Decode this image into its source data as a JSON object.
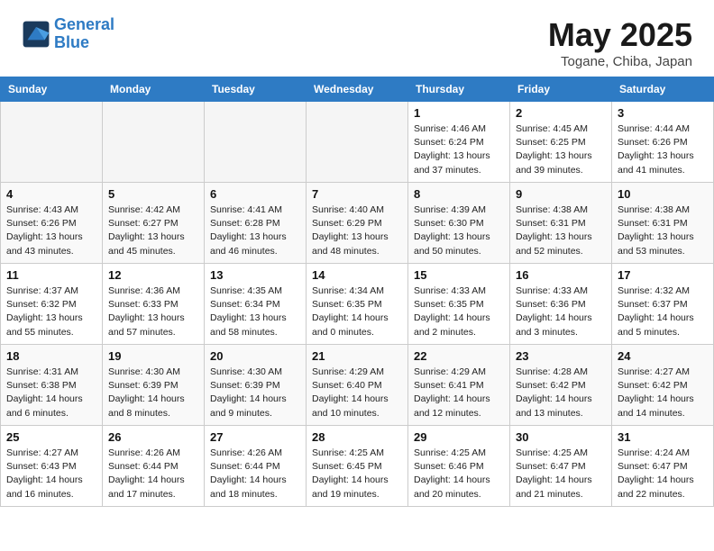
{
  "header": {
    "logo_line1": "General",
    "logo_line2": "Blue",
    "month": "May 2025",
    "location": "Togane, Chiba, Japan"
  },
  "weekdays": [
    "Sunday",
    "Monday",
    "Tuesday",
    "Wednesday",
    "Thursday",
    "Friday",
    "Saturday"
  ],
  "weeks": [
    [
      {
        "day": "",
        "info": ""
      },
      {
        "day": "",
        "info": ""
      },
      {
        "day": "",
        "info": ""
      },
      {
        "day": "",
        "info": ""
      },
      {
        "day": "1",
        "info": "Sunrise: 4:46 AM\nSunset: 6:24 PM\nDaylight: 13 hours\nand 37 minutes."
      },
      {
        "day": "2",
        "info": "Sunrise: 4:45 AM\nSunset: 6:25 PM\nDaylight: 13 hours\nand 39 minutes."
      },
      {
        "day": "3",
        "info": "Sunrise: 4:44 AM\nSunset: 6:26 PM\nDaylight: 13 hours\nand 41 minutes."
      }
    ],
    [
      {
        "day": "4",
        "info": "Sunrise: 4:43 AM\nSunset: 6:26 PM\nDaylight: 13 hours\nand 43 minutes."
      },
      {
        "day": "5",
        "info": "Sunrise: 4:42 AM\nSunset: 6:27 PM\nDaylight: 13 hours\nand 45 minutes."
      },
      {
        "day": "6",
        "info": "Sunrise: 4:41 AM\nSunset: 6:28 PM\nDaylight: 13 hours\nand 46 minutes."
      },
      {
        "day": "7",
        "info": "Sunrise: 4:40 AM\nSunset: 6:29 PM\nDaylight: 13 hours\nand 48 minutes."
      },
      {
        "day": "8",
        "info": "Sunrise: 4:39 AM\nSunset: 6:30 PM\nDaylight: 13 hours\nand 50 minutes."
      },
      {
        "day": "9",
        "info": "Sunrise: 4:38 AM\nSunset: 6:31 PM\nDaylight: 13 hours\nand 52 minutes."
      },
      {
        "day": "10",
        "info": "Sunrise: 4:38 AM\nSunset: 6:31 PM\nDaylight: 13 hours\nand 53 minutes."
      }
    ],
    [
      {
        "day": "11",
        "info": "Sunrise: 4:37 AM\nSunset: 6:32 PM\nDaylight: 13 hours\nand 55 minutes."
      },
      {
        "day": "12",
        "info": "Sunrise: 4:36 AM\nSunset: 6:33 PM\nDaylight: 13 hours\nand 57 minutes."
      },
      {
        "day": "13",
        "info": "Sunrise: 4:35 AM\nSunset: 6:34 PM\nDaylight: 13 hours\nand 58 minutes."
      },
      {
        "day": "14",
        "info": "Sunrise: 4:34 AM\nSunset: 6:35 PM\nDaylight: 14 hours\nand 0 minutes."
      },
      {
        "day": "15",
        "info": "Sunrise: 4:33 AM\nSunset: 6:35 PM\nDaylight: 14 hours\nand 2 minutes."
      },
      {
        "day": "16",
        "info": "Sunrise: 4:33 AM\nSunset: 6:36 PM\nDaylight: 14 hours\nand 3 minutes."
      },
      {
        "day": "17",
        "info": "Sunrise: 4:32 AM\nSunset: 6:37 PM\nDaylight: 14 hours\nand 5 minutes."
      }
    ],
    [
      {
        "day": "18",
        "info": "Sunrise: 4:31 AM\nSunset: 6:38 PM\nDaylight: 14 hours\nand 6 minutes."
      },
      {
        "day": "19",
        "info": "Sunrise: 4:30 AM\nSunset: 6:39 PM\nDaylight: 14 hours\nand 8 minutes."
      },
      {
        "day": "20",
        "info": "Sunrise: 4:30 AM\nSunset: 6:39 PM\nDaylight: 14 hours\nand 9 minutes."
      },
      {
        "day": "21",
        "info": "Sunrise: 4:29 AM\nSunset: 6:40 PM\nDaylight: 14 hours\nand 10 minutes."
      },
      {
        "day": "22",
        "info": "Sunrise: 4:29 AM\nSunset: 6:41 PM\nDaylight: 14 hours\nand 12 minutes."
      },
      {
        "day": "23",
        "info": "Sunrise: 4:28 AM\nSunset: 6:42 PM\nDaylight: 14 hours\nand 13 minutes."
      },
      {
        "day": "24",
        "info": "Sunrise: 4:27 AM\nSunset: 6:42 PM\nDaylight: 14 hours\nand 14 minutes."
      }
    ],
    [
      {
        "day": "25",
        "info": "Sunrise: 4:27 AM\nSunset: 6:43 PM\nDaylight: 14 hours\nand 16 minutes."
      },
      {
        "day": "26",
        "info": "Sunrise: 4:26 AM\nSunset: 6:44 PM\nDaylight: 14 hours\nand 17 minutes."
      },
      {
        "day": "27",
        "info": "Sunrise: 4:26 AM\nSunset: 6:44 PM\nDaylight: 14 hours\nand 18 minutes."
      },
      {
        "day": "28",
        "info": "Sunrise: 4:25 AM\nSunset: 6:45 PM\nDaylight: 14 hours\nand 19 minutes."
      },
      {
        "day": "29",
        "info": "Sunrise: 4:25 AM\nSunset: 6:46 PM\nDaylight: 14 hours\nand 20 minutes."
      },
      {
        "day": "30",
        "info": "Sunrise: 4:25 AM\nSunset: 6:47 PM\nDaylight: 14 hours\nand 21 minutes."
      },
      {
        "day": "31",
        "info": "Sunrise: 4:24 AM\nSunset: 6:47 PM\nDaylight: 14 hours\nand 22 minutes."
      }
    ]
  ]
}
